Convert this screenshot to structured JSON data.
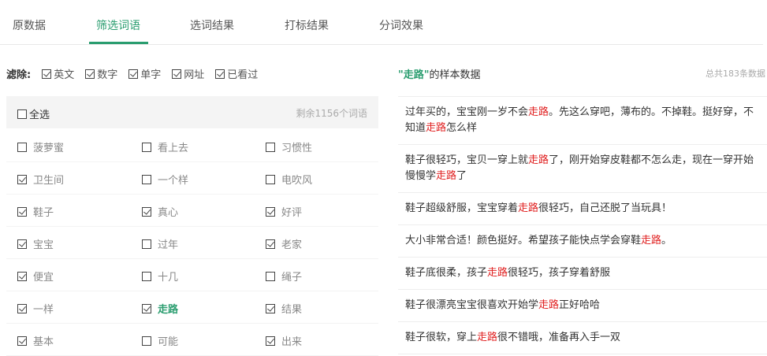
{
  "tabs": [
    "原数据",
    "筛选词语",
    "选词结果",
    "打标结果",
    "分词效果"
  ],
  "active_tab": 1,
  "filter": {
    "label": "滤除:",
    "items": [
      {
        "label": "英文",
        "checked": true
      },
      {
        "label": "数字",
        "checked": true
      },
      {
        "label": "单字",
        "checked": true
      },
      {
        "label": "网址",
        "checked": true
      },
      {
        "label": "已看过",
        "checked": true
      }
    ]
  },
  "word_list": {
    "select_all": "全选",
    "remaining": "剩余1156个词语",
    "rows": [
      [
        {
          "w": "菠萝蜜",
          "c": false
        },
        {
          "w": "看上去",
          "c": false
        },
        {
          "w": "习惯性",
          "c": false
        }
      ],
      [
        {
          "w": "卫生间",
          "c": true
        },
        {
          "w": "一个样",
          "c": false
        },
        {
          "w": "电吹风",
          "c": false
        }
      ],
      [
        {
          "w": "鞋子",
          "c": true
        },
        {
          "w": "真心",
          "c": true
        },
        {
          "w": "好评",
          "c": true
        }
      ],
      [
        {
          "w": "宝宝",
          "c": true
        },
        {
          "w": "过年",
          "c": false
        },
        {
          "w": "老家",
          "c": true
        }
      ],
      [
        {
          "w": "便宜",
          "c": true
        },
        {
          "w": "十几",
          "c": false
        },
        {
          "w": "绳子",
          "c": false
        }
      ],
      [
        {
          "w": "一样",
          "c": true
        },
        {
          "w": "走路",
          "c": true,
          "hl": true
        },
        {
          "w": "结果",
          "c": true
        }
      ],
      [
        {
          "w": "基本",
          "c": true
        },
        {
          "w": "可能",
          "c": false
        },
        {
          "w": "出来",
          "c": true
        }
      ]
    ]
  },
  "samples_panel": {
    "keyword_quoted": "\"走路\"",
    "title_suffix": "的样本数据",
    "total": "总共183条数据",
    "samples": [
      [
        {
          "t": "过年买的，宝宝刚一岁不会"
        },
        {
          "t": "走路",
          "k": true
        },
        {
          "t": "。先这么穿吧，薄布的。不掉鞋。挺好穿，不知道"
        },
        {
          "t": "走路",
          "k": true
        },
        {
          "t": "怎么样"
        }
      ],
      [
        {
          "t": "鞋子很轻巧，宝贝一穿上就"
        },
        {
          "t": "走路",
          "k": true
        },
        {
          "t": "了，刚开始穿皮鞋都不怎么走，现在一穿开始慢慢学"
        },
        {
          "t": "走路",
          "k": true
        },
        {
          "t": "了"
        }
      ],
      [
        {
          "t": "鞋子超级舒服，宝宝穿着"
        },
        {
          "t": "走路",
          "k": true
        },
        {
          "t": "很轻巧，自己还脱了当玩具！"
        }
      ],
      [
        {
          "t": "大小非常合适！颜色挺好。希望孩子能快点学会穿鞋"
        },
        {
          "t": "走路",
          "k": true
        },
        {
          "t": "。"
        }
      ],
      [
        {
          "t": "鞋子底很柔，孩子"
        },
        {
          "t": "走路",
          "k": true
        },
        {
          "t": "很轻巧，孩子穿着舒服"
        }
      ],
      [
        {
          "t": "鞋子很漂亮宝宝很喜欢开始学"
        },
        {
          "t": "走路",
          "k": true
        },
        {
          "t": "正好哈哈"
        }
      ],
      [
        {
          "t": "鞋子很软，穿上"
        },
        {
          "t": "走路",
          "k": true
        },
        {
          "t": "很不错哦，准备再入手一双"
        }
      ]
    ]
  }
}
